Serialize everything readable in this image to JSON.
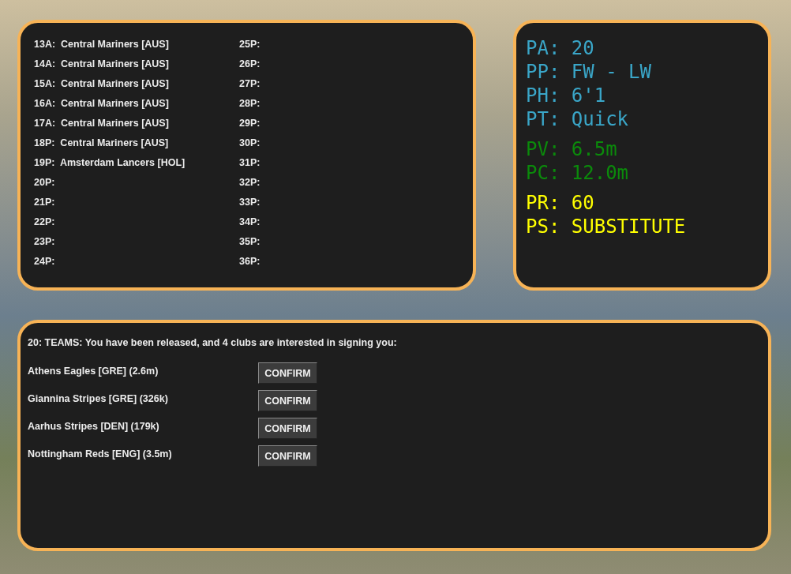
{
  "history": {
    "columns": [
      [
        "13A:  Central Mariners [AUS]",
        "14A:  Central Mariners [AUS]",
        "15A:  Central Mariners [AUS]",
        "16A:  Central Mariners [AUS]",
        "17A:  Central Mariners [AUS]",
        "18P:  Central Mariners [AUS]",
        "19P:  Amsterdam Lancers [HOL]",
        "20P:",
        "21P:",
        "22P:",
        "23P:",
        "24P:"
      ],
      [
        "25P:",
        "26P:",
        "27P:",
        "28P:",
        "29P:",
        "30P:",
        "31P:",
        "32P:",
        "33P:",
        "34P:",
        "35P:",
        "36P:"
      ]
    ]
  },
  "stats": {
    "groups": [
      {
        "color": "#3aa6c8",
        "lines": [
          "PA: 20",
          "PP: FW - LW",
          "PH: 6'1",
          "PT: Quick"
        ]
      },
      {
        "color": "#0b8a0b",
        "lines": [
          "PV: 6.5m",
          "PC: 12.0m"
        ]
      },
      {
        "color": "#ffff00",
        "lines": [
          "PR: 60",
          "PS: SUBSTITUTE"
        ]
      }
    ]
  },
  "offers": {
    "title": "20: TEAMS: You have been released, and 4 clubs are interested in signing you:",
    "rows": [
      {
        "club": "Athens Eagles [GRE] (2.6m)",
        "button": "CONFIRM"
      },
      {
        "club": "Giannina Stripes [GRE] (326k)",
        "button": "CONFIRM"
      },
      {
        "club": "Aarhus Stripes [DEN] (179k)",
        "button": "CONFIRM"
      },
      {
        "club": "Nottingham Reds [ENG] (3.5m)",
        "button": "CONFIRM"
      }
    ]
  }
}
